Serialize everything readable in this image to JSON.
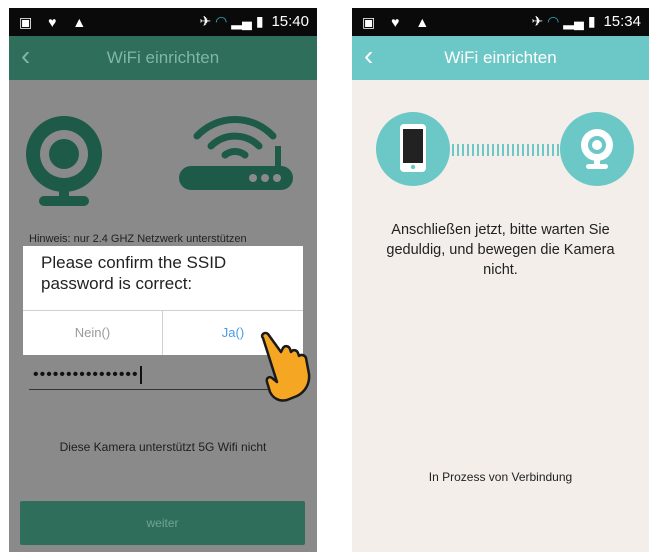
{
  "left_screen": {
    "status_bar": {
      "time": "15:40"
    },
    "header": {
      "back_icon": "chevron-left-icon",
      "title": "WiFi einrichten"
    },
    "hint": "Hinweis: nur 2.4 GHZ Netzwerk unterstützen",
    "dialog": {
      "message": "Please confirm the SSID password is correct:",
      "no_label": "Nein()",
      "yes_label": "Ja()"
    },
    "password_field": {
      "value": "••••••••••••••••"
    },
    "note_5g": "Diese Kamera unterstützt 5G Wifi nicht",
    "next_button": "weiter",
    "colors": {
      "header": "#2f6e5b",
      "overlay": "#8a8a8a",
      "yes": "#4b9be6"
    },
    "icons": [
      "camera-icon",
      "router-icon",
      "pointing-hand-icon"
    ]
  },
  "right_screen": {
    "status_bar": {
      "time": "15:34"
    },
    "header": {
      "back_icon": "chevron-left-icon",
      "title": "WiFi einrichten"
    },
    "message": "Anschließen jetzt, bitte warten Sie geduldig, und bewegen die Kamera nicht.",
    "status": "In Prozess von Verbindung",
    "colors": {
      "header": "#6bc8c6",
      "background": "#f3eeea"
    },
    "icons": [
      "phone-icon",
      "camera-icon"
    ]
  }
}
